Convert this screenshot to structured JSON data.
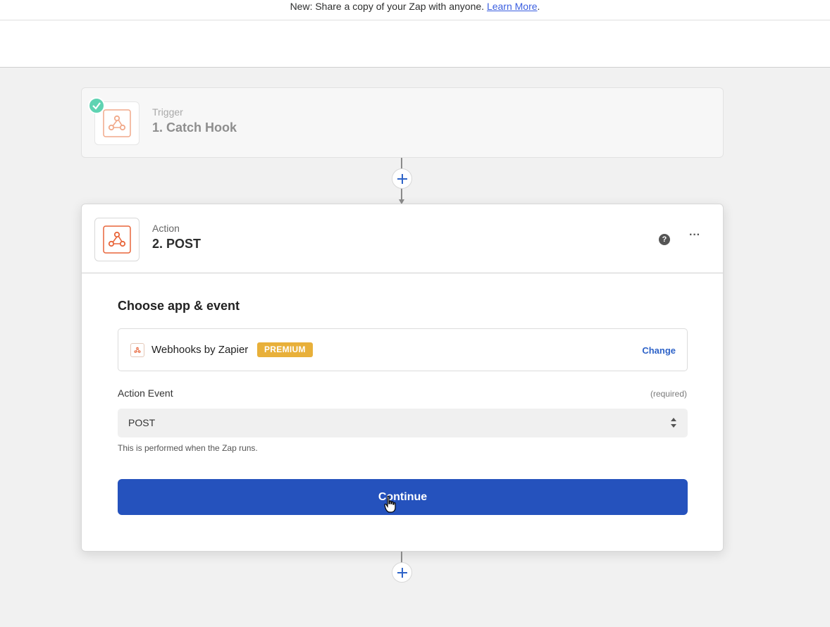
{
  "banner": {
    "text": "New: Share a copy of your Zap with anyone.",
    "link": "Learn More",
    "trailing": "."
  },
  "trigger_step": {
    "kind": "Trigger",
    "title": "1. Catch Hook",
    "status": "complete",
    "icon": "webhook-icon"
  },
  "action_step": {
    "kind": "Action",
    "title": "2. POST",
    "icon": "webhook-icon",
    "section_title": "Choose app & event",
    "app": {
      "name": "Webhooks by Zapier",
      "badge": "PREMIUM",
      "change_label": "Change"
    },
    "event": {
      "label": "Action Event",
      "required_label": "(required)",
      "value": "POST",
      "hint": "This is performed when the Zap runs."
    },
    "continue_label": "Continue"
  },
  "colors": {
    "accent": "#2552bd",
    "brand_orange": "#e8653a",
    "premium": "#e8b03a",
    "success": "#5fd3b2"
  }
}
